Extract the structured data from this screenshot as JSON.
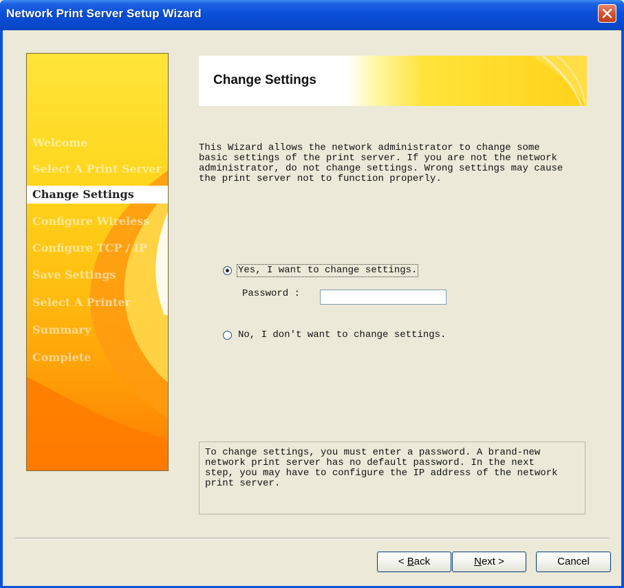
{
  "window": {
    "title": "Network Print Server Setup Wizard",
    "close_icon": "close-icon"
  },
  "sidebar": {
    "steps": [
      {
        "label": "Welcome",
        "active": false
      },
      {
        "label": "Select A Print Server",
        "active": false
      },
      {
        "label": "Change Settings",
        "active": true
      },
      {
        "label": "Configure Wireless",
        "active": false
      },
      {
        "label": "Configure TCP / IP",
        "active": false
      },
      {
        "label": "Save Settings",
        "active": false
      },
      {
        "label": "Select A Printer",
        "active": false
      },
      {
        "label": "Summary",
        "active": false
      },
      {
        "label": "Complete",
        "active": false
      }
    ]
  },
  "header": {
    "title": "Change Settings"
  },
  "intro": {
    "lines": [
      "This Wizard allows the network administrator to change some",
      "basic settings of the print server. If you are not the network",
      "administrator, do not change settings. Wrong settings may cause",
      "the print server not to function properly."
    ]
  },
  "options": {
    "yes_label": "Yes, I want to change settings.",
    "yes_selected": true,
    "password_label": "Password :",
    "password_value": "",
    "no_label": "No, I don't want to change settings.",
    "no_selected": false
  },
  "info": {
    "lines": [
      "To change settings, you must enter a password. A brand-new",
      "network print server has no default password. In the next",
      "step, you may have to configure the IP address of the network",
      "print server."
    ]
  },
  "buttons": {
    "back_prefix": "< ",
    "back_key": "B",
    "back_rest": "ack",
    "next_key": "N",
    "next_rest": "ext >",
    "cancel": "Cancel"
  },
  "colors": {
    "titlebar": "#0a4fd8",
    "dialog_bg": "#ece9d8",
    "accent_yellow": "#ffd21a",
    "accent_orange": "#ff8a00"
  }
}
